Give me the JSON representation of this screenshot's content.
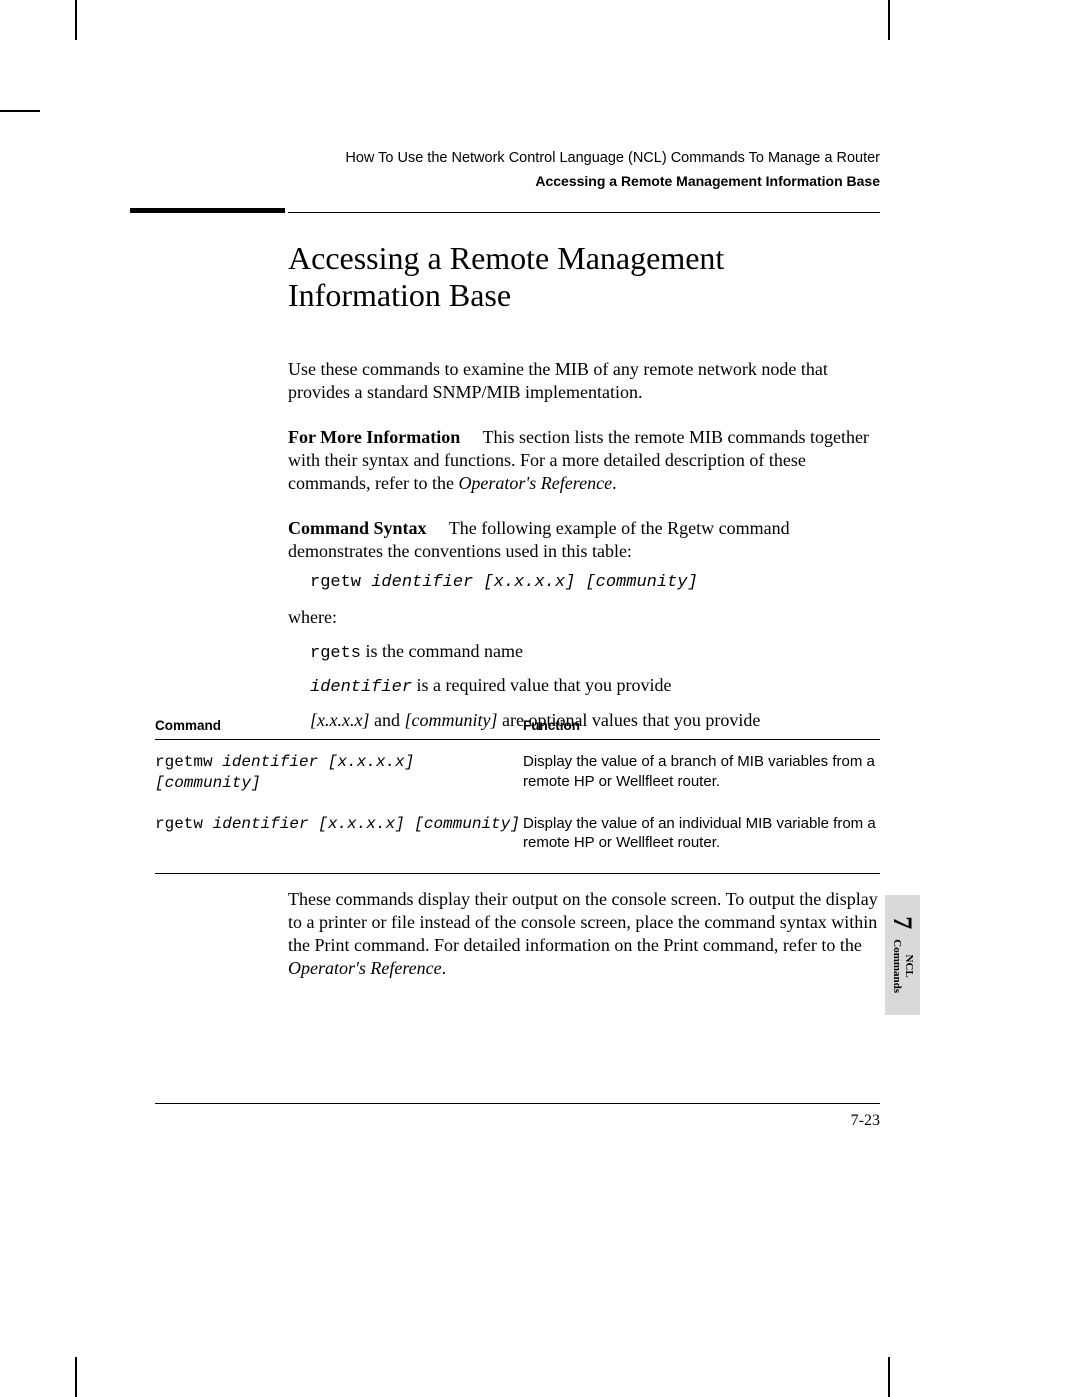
{
  "running_head": {
    "chapter": "How To Use the Network Control Language (NCL) Commands To Manage a Router",
    "section": "Accessing a Remote Management Information Base"
  },
  "title": "Accessing a Remote Management Information Base",
  "intro": "Use these commands to examine the MIB of any remote network node that provides a standard SNMP/MIB implementation.",
  "more_info": {
    "label": "For More  Information",
    "text_a": "This section lists the remote MIB commands together with their syntax and functions. For a more detailed description of these commands, refer to  the ",
    "ref": "Operator's Reference",
    "text_b": "."
  },
  "cmd_syntax": {
    "label": "Command Syntax",
    "text": "The following example of the Rgetw command demonstrates the conventions used in  this table:"
  },
  "syntax_example": {
    "cmd": "rgetw ",
    "args": "identifier [x.x.x.x] [community]"
  },
  "where_label": "where:",
  "where_items": {
    "l1_a": "rgets",
    "l1_b": " is the command name",
    "l2_a": "identifier",
    "l2_b": "  is a required value that you provide",
    "l3_a": "[x.x.x.x]",
    "l3_b": " and ",
    "l3_c": "[community]",
    "l3_d": " are optional values that you provide"
  },
  "table": {
    "head_cmd": "Command",
    "head_func": "Function",
    "rows": [
      {
        "cmd_a": "rgetmw ",
        "cmd_b": "identifier [x.x.x.x] [community]",
        "func": "Display the value of a branch of MIB variables from a remote HP or Wellfleet router."
      },
      {
        "cmd_a": "rgetw ",
        "cmd_b": "identifier [x.x.x.x] [community]",
        "func": "Display the value of an individual MIB variable from a remote HP or Wellfleet router."
      }
    ]
  },
  "outro": {
    "text_a": "These commands display their output on the console screen. To output the display to a printer or file instead of the console screen, place the command syntax within the Print command. For detailed information on the Print command, refer to the ",
    "ref": "Operator's Reference",
    "text_b": "."
  },
  "side_tab": {
    "num": "7",
    "line1": "NCL",
    "line2": "Commands"
  },
  "page_number": "7-23"
}
